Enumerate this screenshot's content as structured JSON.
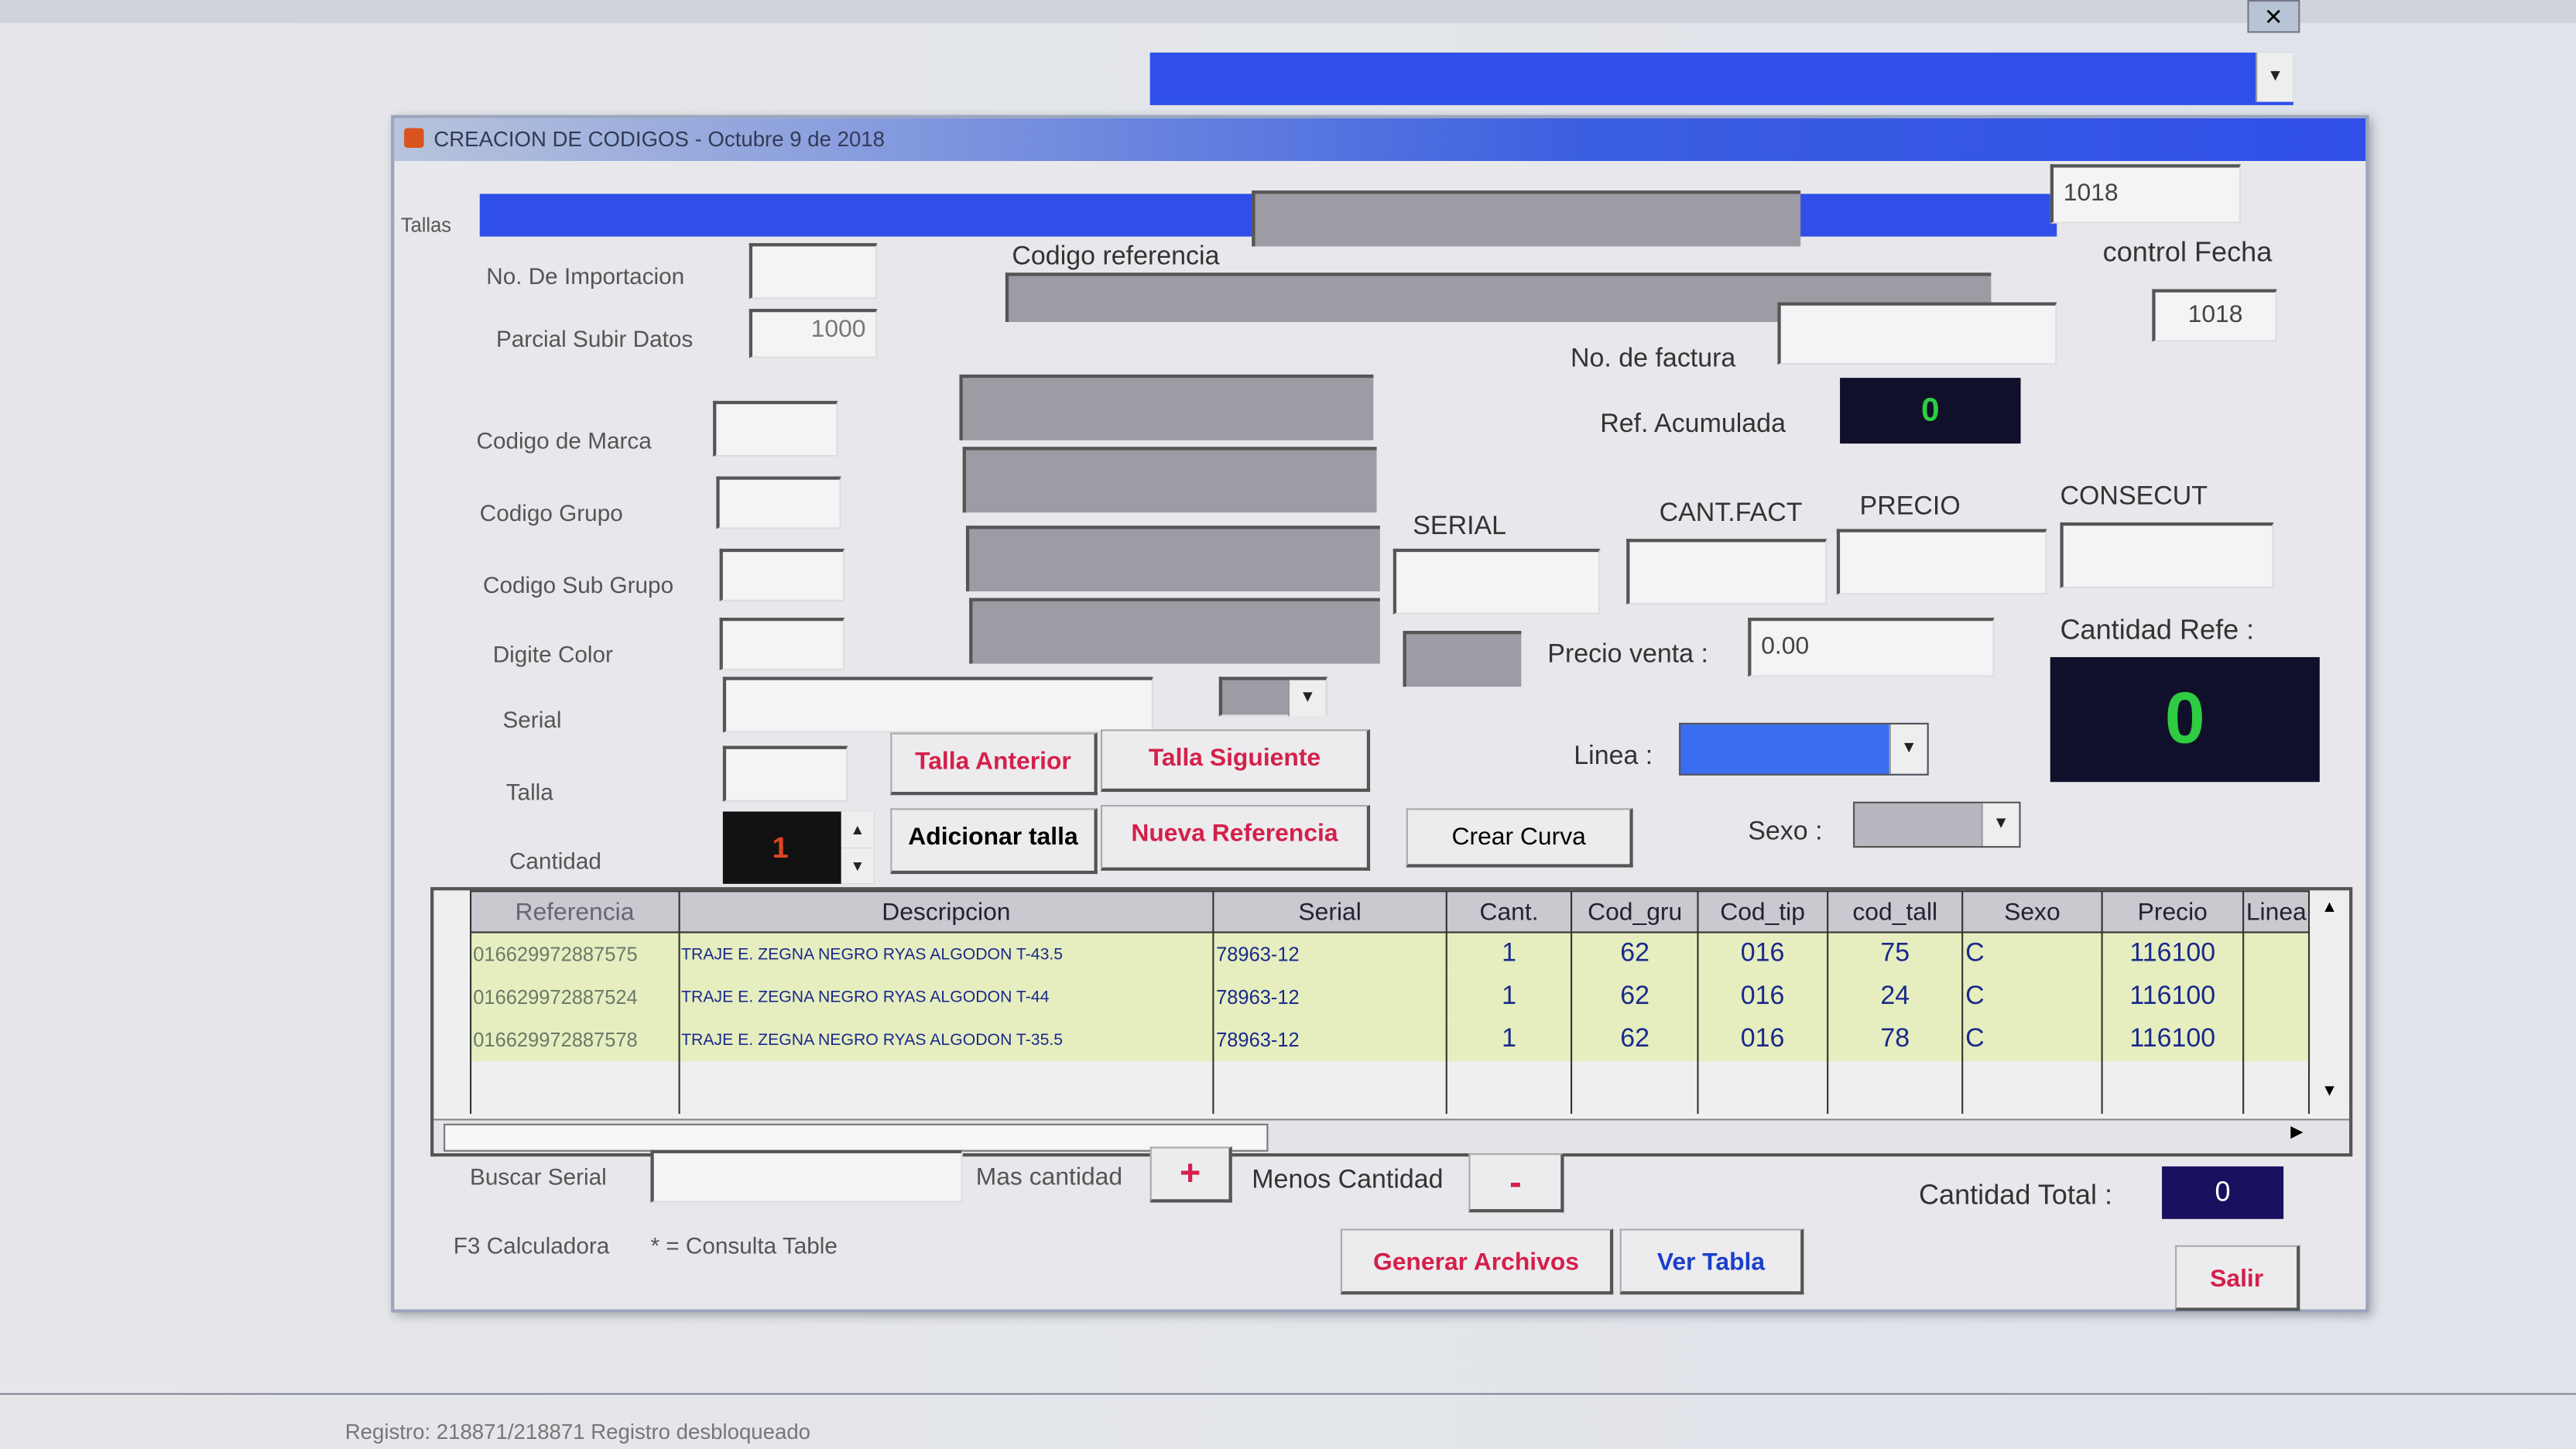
{
  "window": {
    "title": "CREACION DE CODIGOS - Octubre 9 de 2018",
    "close_icon": "close-icon"
  },
  "top_right": {
    "field1": "1018",
    "field2": "1018",
    "control_label": "control Fecha"
  },
  "form": {
    "tallas_label": "Tallas",
    "no_importacion_label": "No. De Importacion",
    "no_importacion_value": "",
    "parcial_label": "Parcial Subir Datos",
    "parcial_value": "1000",
    "codigo_referencia_label": "Codigo referencia",
    "no_factura_label": "No. de factura",
    "ref_acumulada_label": "Ref. Acumulada",
    "ref_acumulada_value": "0",
    "codigo_marca_label": "Codigo de Marca",
    "codigo_grupo_label": "Codigo Grupo",
    "codigo_subgrupo_label": "Codigo Sub Grupo",
    "digite_color_label": "Digite Color",
    "serial_label": "Serial",
    "talla_label": "Talla",
    "cantidad_label": "Cantidad",
    "cantidad_value": "1",
    "serial_col": "SERIAL",
    "cant_fact_col": "CANT.FACT",
    "precio_col": "PRECIO",
    "consecut_col": "CONSECUT",
    "precio_venta_label": "Precio venta :",
    "precio_venta_value": "0.00",
    "cantidad_refe_label": "Cantidad Refe :",
    "cantidad_refe_value": "0",
    "linea_label": "Linea :",
    "sexo_label": "Sexo :"
  },
  "buttons": {
    "talla_anterior": "Talla Anterior",
    "talla_siguiente": "Talla Siguiente",
    "adicionar_talla": "Adicionar talla",
    "nueva_referencia": "Nueva Referencia",
    "crear_curva": "Crear Curva",
    "generar_archivos": "Generar Archivos",
    "ver_tabla": "Ver Tabla",
    "salir": "Salir",
    "mas": "+",
    "menos": "-"
  },
  "table": {
    "columns": [
      "Referencia",
      "Descripcion",
      "Serial",
      "Cant.",
      "Cod_gru",
      "Cod_tip",
      "cod_tall",
      "Sexo",
      "Precio",
      "Linea"
    ],
    "rows": [
      [
        "016629972887575",
        "TRAJE E. ZEGNA NEGRO RYAS ALGODON T-43.5",
        "78963-12",
        "1",
        "62",
        "016",
        "75",
        "C",
        "116100",
        ""
      ],
      [
        "016629972887524",
        "TRAJE E. ZEGNA NEGRO RYAS ALGODON T-44",
        "78963-12",
        "1",
        "62",
        "016",
        "24",
        "C",
        "116100",
        ""
      ],
      [
        "016629972887578",
        "TRAJE E. ZEGNA NEGRO RYAS ALGODON T-35.5",
        "78963-12",
        "1",
        "62",
        "016",
        "78",
        "C",
        "116100",
        ""
      ]
    ]
  },
  "bottom": {
    "buscar_serial_label": "Buscar Serial",
    "mas_cantidad_label": "Mas cantidad",
    "menos_cantidad_label": "Menos Cantidad",
    "cantidad_total_label": "Cantidad Total :",
    "cantidad_total_value": "0",
    "hint_f3": "F3 Calculadora",
    "hint_consulta": "* = Consulta Table"
  },
  "statusbar": {
    "text": "Registro: 218871/218871   Registro desbloqueado"
  }
}
